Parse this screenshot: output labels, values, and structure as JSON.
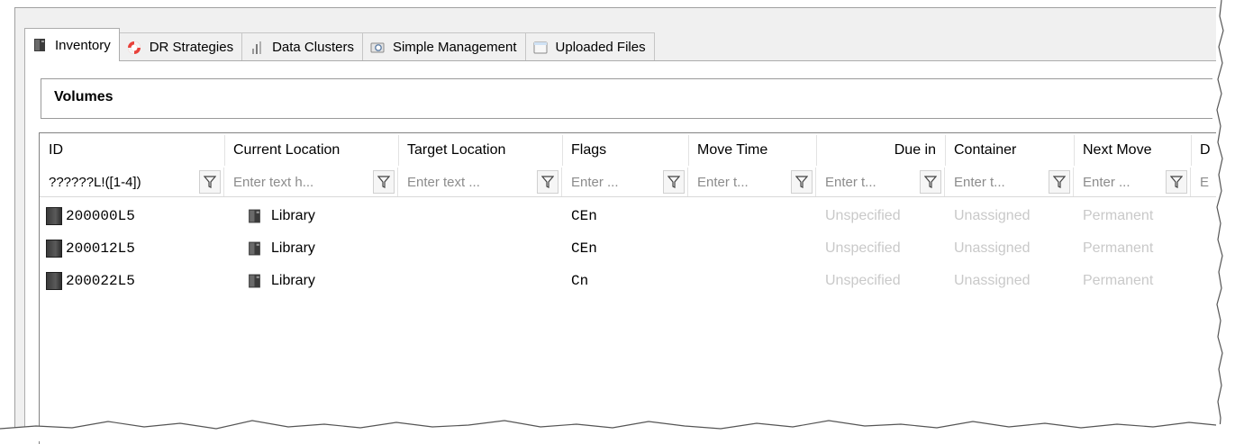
{
  "tabs": [
    {
      "label": "Inventory",
      "icon": "tape-library-icon",
      "active": true
    },
    {
      "label": "DR Strategies",
      "icon": "lifebuoy-icon",
      "active": false
    },
    {
      "label": "Data Clusters",
      "icon": "data-cluster-icon",
      "active": false
    },
    {
      "label": "Simple Management",
      "icon": "simple-management-icon",
      "active": false
    },
    {
      "label": "Uploaded Files",
      "icon": "uploaded-files-icon",
      "active": false
    }
  ],
  "group_title": "Volumes",
  "columns": [
    {
      "label": "ID",
      "filter": "??????L!([1-4])"
    },
    {
      "label": "Current Location",
      "filter": "Enter text h..."
    },
    {
      "label": "Target Location",
      "filter": "Enter text ..."
    },
    {
      "label": "Flags",
      "filter": "Enter ..."
    },
    {
      "label": "Move Time",
      "filter": "Enter t..."
    },
    {
      "label": "Due in",
      "filter": "Enter t..."
    },
    {
      "label": "Container",
      "filter": "Enter t..."
    },
    {
      "label": "Next Move",
      "filter": "Enter ..."
    },
    {
      "label": "D",
      "filter": "E"
    }
  ],
  "rows": [
    {
      "id": "200000L5",
      "current_location": "Library",
      "target_location": "",
      "flags": "CEn",
      "move_time": "",
      "due_in": "Unspecified",
      "container": "Unassigned",
      "next_move": "Permanent"
    },
    {
      "id": "200012L5",
      "current_location": "Library",
      "target_location": "",
      "flags": "CEn",
      "move_time": "",
      "due_in": "Unspecified",
      "container": "Unassigned",
      "next_move": "Permanent"
    },
    {
      "id": "200022L5",
      "current_location": "Library",
      "target_location": "",
      "flags": "Cn",
      "move_time": "",
      "due_in": "Unspecified",
      "container": "Unassigned",
      "next_move": "Permanent"
    }
  ],
  "colors": {
    "muted_text": "#c9c9c9",
    "tab_active_bg": "#ffffff",
    "tab_bg": "#f0f0f0",
    "lifebuoy": "#e8413a"
  }
}
